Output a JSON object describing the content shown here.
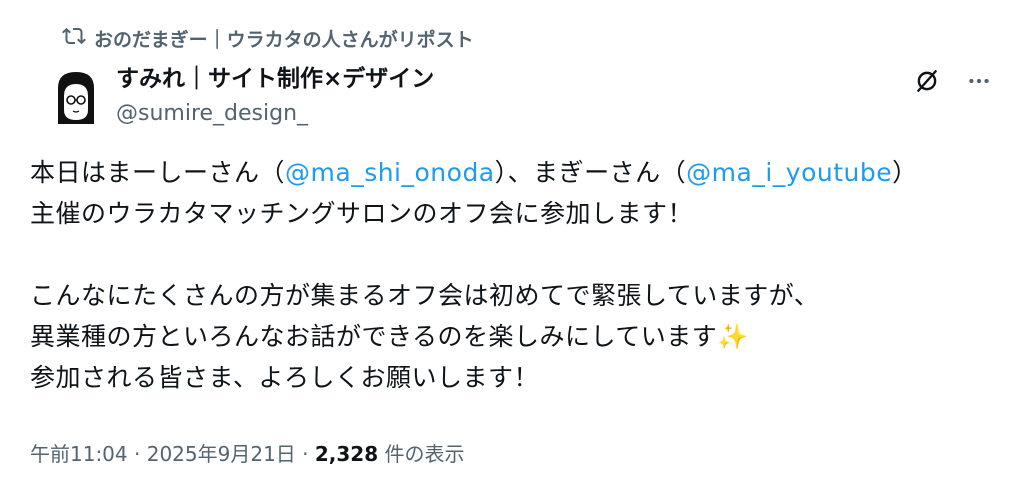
{
  "repost": {
    "text": "おのだまぎー｜ウラカタの人さんがリポスト",
    "icon": "repost-icon"
  },
  "author": {
    "display_name": "すみれ｜サイト制作×デザイン",
    "handle": "@sumire_design_",
    "avatar_icon": "avatar-glasses-illustration"
  },
  "actions": {
    "grok_icon": "grok-icon",
    "more_icon": "more-icon"
  },
  "tweet": {
    "line1_a": "本日はまーしーさん（",
    "mention1": "@ma_shi_onoda",
    "line1_b": "）、まぎーさん（",
    "mention2": "@ma_i_youtube",
    "line1_c": "）",
    "line2": "主催のウラカタマッチングサロンのオフ会に参加します！",
    "line3": "こんなにたくさんの方が集まるオフ会は初めてで緊張していますが、",
    "line4": "異業種の方といろんなお話ができるのを楽しみにしています",
    "sparkle": "✨",
    "line5": "参加される皆さま、よろしくお願いします！"
  },
  "meta": {
    "time": "午前11:04",
    "sep1": " · ",
    "date": "2025年9月21日",
    "sep2": " · ",
    "views_count": "2,328",
    "views_label": " 件の表示"
  },
  "colors": {
    "text": "#0f1419",
    "secondary": "#536471",
    "link": "#1d9bf0"
  }
}
